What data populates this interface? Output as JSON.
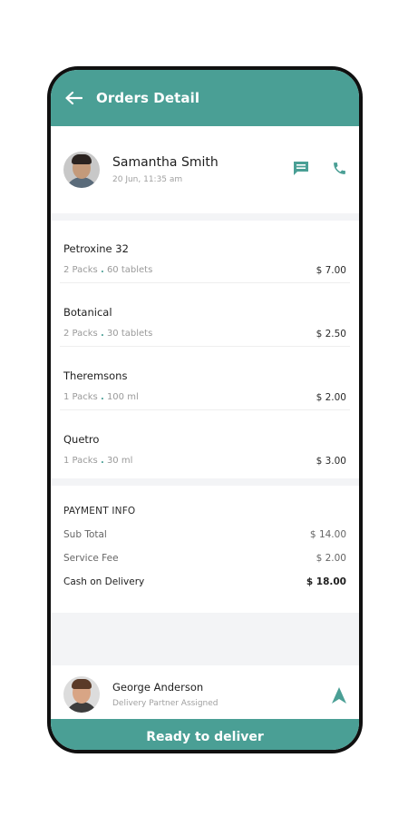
{
  "appbar": {
    "title": "Orders Detail"
  },
  "customer": {
    "name": "Samantha Smith",
    "time": "20 Jun, 11:35 am"
  },
  "items": [
    {
      "name": "Petroxine 32",
      "packs": "2 Packs",
      "detail": "60 tablets",
      "price": "$ 7.00"
    },
    {
      "name": "Botanical",
      "packs": "2 Packs",
      "detail": "30 tablets",
      "price": "$ 2.50"
    },
    {
      "name": "Theremsons",
      "packs": "1 Packs",
      "detail": "100 ml",
      "price": "$ 2.00"
    },
    {
      "name": "Quetro",
      "packs": "1 Packs",
      "detail": "30 ml",
      "price": "$ 3.00"
    }
  ],
  "payment": {
    "heading": "PAYMENT INFO",
    "subtotal_label": "Sub Total",
    "subtotal_value": "$ 14.00",
    "fee_label": "Service Fee",
    "fee_value": "$ 2.00",
    "total_label": "Cash on Delivery",
    "total_value": "$ 18.00"
  },
  "partner": {
    "name": "George Anderson",
    "role": "Delivery Partner Assigned"
  },
  "cta": {
    "label": "Ready to deliver"
  },
  "colors": {
    "accent": "#4a9f95",
    "band": "#f3f4f6"
  },
  "icons": [
    "back-arrow-icon",
    "chat-icon",
    "phone-icon",
    "navigation-arrow-icon"
  ]
}
